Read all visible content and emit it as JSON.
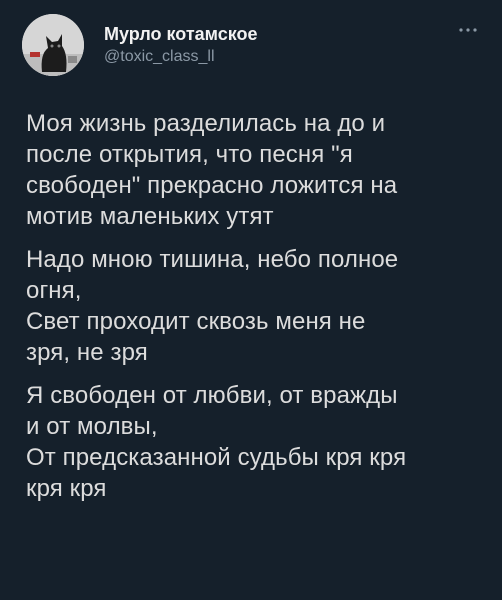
{
  "tweet": {
    "author": {
      "name": "Мурло котамское",
      "handle": "@toxic_class_ll"
    },
    "more_icon": "ellipsis-icon",
    "paragraphs": [
      [
        "Моя жизнь разделилась на до и",
        "после открытия, что песня \"я",
        "свободен\" прекрасно ложится на",
        "мотив маленьких утят"
      ],
      [
        "Надо мною тишина, небо полное",
        "огня,",
        "Свет проходит сквозь меня не",
        "зря, не зря"
      ],
      [
        "Я свободен от любви, от вражды",
        "и от молвы,",
        "От предсказанной судьбы кря кря",
        "кря кря"
      ]
    ]
  },
  "colors": {
    "background": "#15202b",
    "text": "#dcdcdc",
    "handle": "#8b98a5"
  }
}
